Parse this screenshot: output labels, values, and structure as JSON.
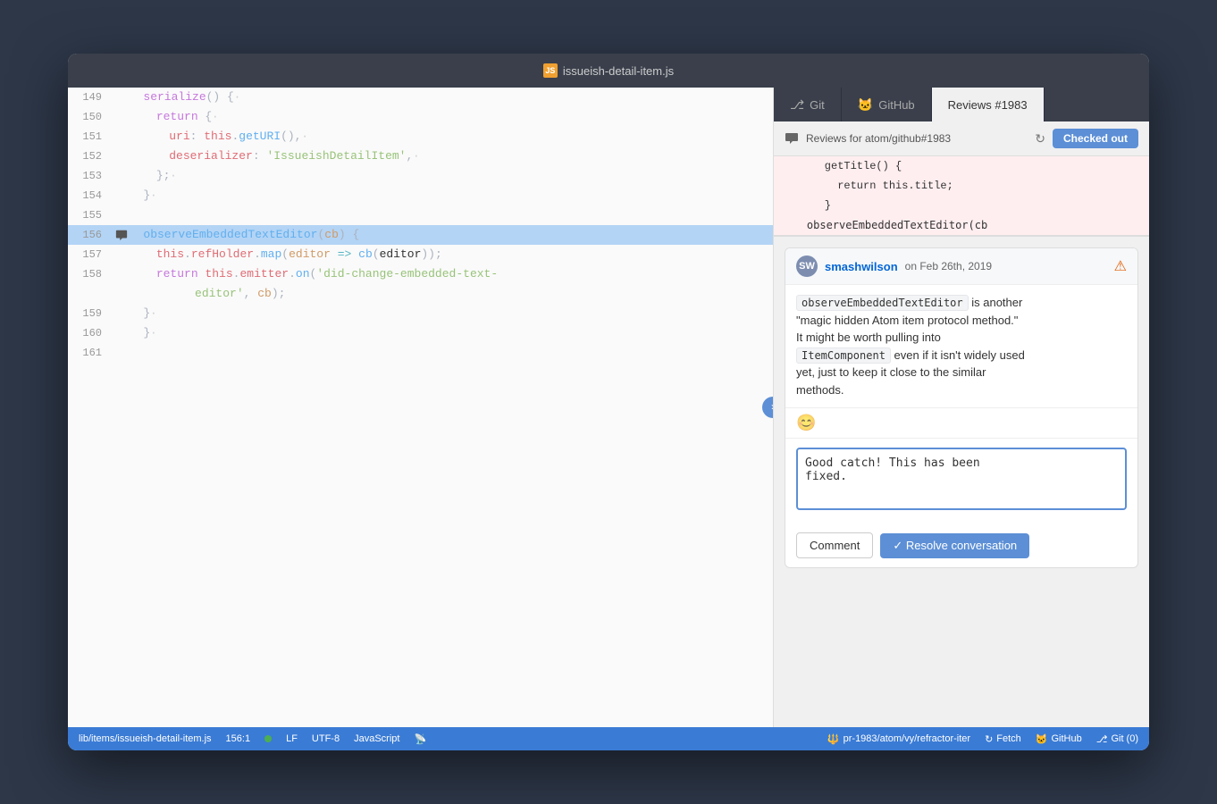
{
  "titleBar": {
    "title": "issueish-detail-item.js",
    "fileIconLabel": "JS"
  },
  "tabs": [
    {
      "label": "Git",
      "icon": "⎇",
      "active": false
    },
    {
      "label": "GitHub",
      "icon": "🐱",
      "active": false
    },
    {
      "label": "Reviews #1983",
      "active": true
    }
  ],
  "reviewsHeader": {
    "label": "Reviews for atom/github#1983",
    "checkedOutLabel": "Checked out"
  },
  "diffCode": {
    "line1": "    getTitle() {",
    "line2": "      return this.title;",
    "line3": "    }",
    "overflowLine": "    observeEmbeddedTextEditor(cb"
  },
  "comment": {
    "author": "smashwilson",
    "date": "on Feb 26th, 2019",
    "body1": "observeEmbeddedTextEditor",
    "body2": " is another",
    "body3": "\"magic hidden Atom item protocol method.\"",
    "body4": "It might be worth pulling into",
    "body5": "ItemComponent",
    "body6": " even if it isn't widely used",
    "body7": "yet, just to keep it close to the similar",
    "body8": "methods.",
    "emoji": "😊"
  },
  "replyText": "Good catch! This has been\nfixed.",
  "buttons": {
    "comment": "Comment",
    "resolve": "✓  Resolve conversation"
  },
  "codeLines": [
    {
      "num": "149",
      "indent": "  ·",
      "content": "serialize() {·"
    },
    {
      "num": "150",
      "indent": "  ··",
      "content": "return {·"
    },
    {
      "num": "151",
      "indent": "  ····",
      "content": "uri: this.getURI(),·"
    },
    {
      "num": "152",
      "indent": "  ····",
      "content": "deserializer: 'IssueishDetailItem',·"
    },
    {
      "num": "153",
      "indent": "  ··",
      "content": "};·"
    },
    {
      "num": "154",
      "indent": "  ·",
      "content": "}·"
    },
    {
      "num": "155",
      "indent": "",
      "content": ""
    },
    {
      "num": "156",
      "indent": "  ·",
      "content": "observeEmbeddedTextEditor(cb) {",
      "highlighted": true,
      "hasComment": true
    },
    {
      "num": "157",
      "indent": "  ··",
      "content": "this.refHolder.map(editor => cb(editor));"
    },
    {
      "num": "158",
      "indent": "  ··",
      "content": "return this.emitter.on('did-change-embedded-text-"
    },
    {
      "num": "",
      "indent": "      ",
      "content": "editor', cb);"
    },
    {
      "num": "159",
      "indent": "  ·",
      "content": "}·"
    },
    {
      "num": "160",
      "indent": "  ",
      "content": "}·"
    },
    {
      "num": "161",
      "indent": "",
      "content": ""
    }
  ],
  "statusBar": {
    "filePath": "lib/items/issueish-detail-item.js",
    "position": "156:1",
    "encoding": "LF",
    "charset": "UTF-8",
    "language": "JavaScript",
    "branch": "pr-1983/atom/vy/refractor-iter",
    "fetchLabel": "Fetch",
    "githubLabel": "GitHub",
    "gitLabel": "Git (0)"
  }
}
